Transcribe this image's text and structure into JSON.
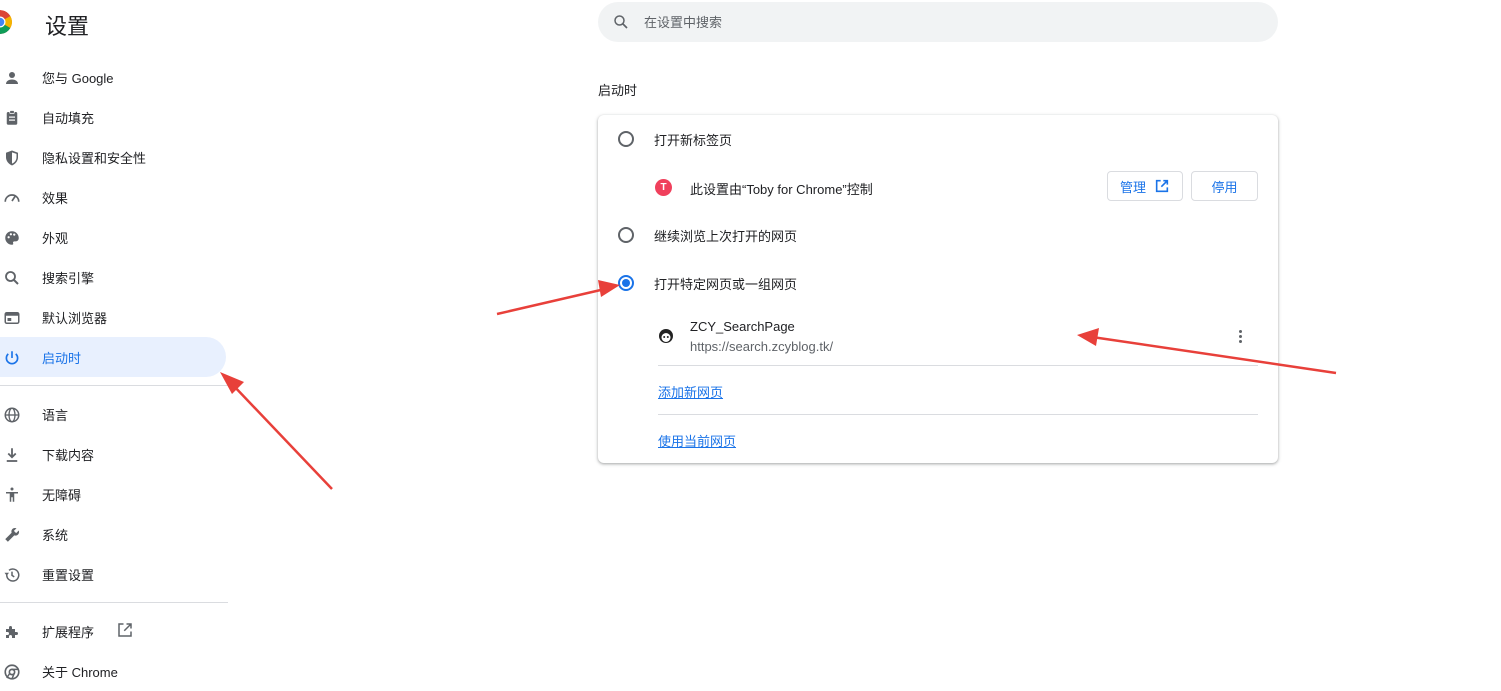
{
  "header": {
    "title": "设置",
    "search_placeholder": "在设置中搜索"
  },
  "sidebar": {
    "items": [
      {
        "label": "您与 Google",
        "icon": "person-icon"
      },
      {
        "label": "自动填充",
        "icon": "clipboard-icon"
      },
      {
        "label": "隐私设置和安全性",
        "icon": "shield-icon"
      },
      {
        "label": "效果",
        "icon": "speedometer-icon"
      },
      {
        "label": "外观",
        "icon": "palette-icon"
      },
      {
        "label": "搜索引擎",
        "icon": "search-icon"
      },
      {
        "label": "默认浏览器",
        "icon": "browser-icon"
      },
      {
        "label": "启动时",
        "icon": "power-icon",
        "active": true
      },
      {
        "label": "语言",
        "icon": "globe-icon"
      },
      {
        "label": "下载内容",
        "icon": "download-icon"
      },
      {
        "label": "无障碍",
        "icon": "accessibility-icon"
      },
      {
        "label": "系统",
        "icon": "wrench-icon"
      },
      {
        "label": "重置设置",
        "icon": "history-icon"
      },
      {
        "label": "扩展程序",
        "icon": "puzzle-icon"
      },
      {
        "label": "关于 Chrome",
        "icon": "chrome-icon"
      }
    ]
  },
  "main": {
    "section_title": "启动时",
    "options": [
      {
        "label": "打开新标签页",
        "checked": false
      },
      {
        "label": "继续浏览上次打开的网页",
        "checked": false
      },
      {
        "label": "打开特定网页或一组网页",
        "checked": true
      }
    ],
    "policy": {
      "text": "此设置由“Toby for Chrome”控制",
      "icon_letter": "T",
      "manage_label": "管理",
      "disable_label": "停用"
    },
    "site": {
      "name": "ZCY_SearchPage",
      "url": "https://search.zcyblog.tk/"
    },
    "add_page_label": "添加新网页",
    "use_current_label": "使用当前网页"
  },
  "colors": {
    "accent": "#1a73e8",
    "active_bg": "#e8f0fe",
    "arrow": "#e8403a"
  }
}
